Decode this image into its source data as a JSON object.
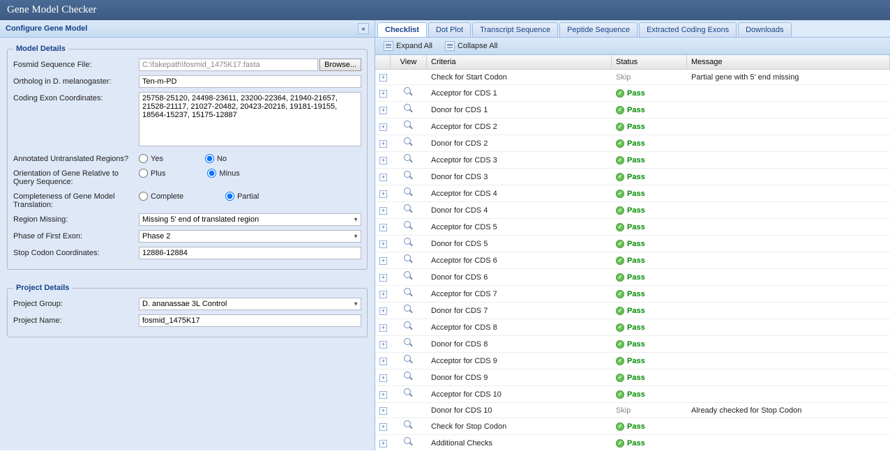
{
  "app": {
    "title": "Gene Model Checker"
  },
  "leftPanel": {
    "title": "Configure Gene Model"
  },
  "modelDetails": {
    "legend": "Model Details",
    "fields": {
      "fosmidLabel": "Fosmid Sequence File:",
      "fosmidValue": "C:\\fakepath\\fosmid_1475K17.fasta",
      "browseLabel": "Browse...",
      "orthologLabel": "Ortholog in D. melanogaster:",
      "orthologValue": "Ten-m-PD",
      "exonLabel": "Coding Exon Coordinates:",
      "exonValue": "25758-25120, 24498-23611, 23200-22364, 21940-21657, 21528-21117, 21027-20482, 20423-20216, 19181-19155, 18564-15237, 15175-12887",
      "utrLabel": "Annotated Untranslated Regions?",
      "utrYes": "Yes",
      "utrNo": "No",
      "orientLabel": "Orientation of Gene Relative to Query Sequence:",
      "orientPlus": "Plus",
      "orientMinus": "Minus",
      "completeLabel": "Completeness of Gene Model Translation:",
      "completeComplete": "Complete",
      "completePartial": "Partial",
      "regionLabel": "Region Missing:",
      "regionValue": "Missing 5' end of translated region",
      "phaseLabel": "Phase of First Exon:",
      "phaseValue": "Phase 2",
      "stopLabel": "Stop Codon Coordinates:",
      "stopValue": "12886-12884"
    }
  },
  "projectDetails": {
    "legend": "Project Details",
    "groupLabel": "Project Group:",
    "groupValue": "D. ananassae 3L Control",
    "nameLabel": "Project Name:",
    "nameValue": "fosmid_1475K17"
  },
  "tabs": [
    "Checklist",
    "Dot Plot",
    "Transcript Sequence",
    "Peptide Sequence",
    "Extracted Coding Exons",
    "Downloads"
  ],
  "toolbar": {
    "expandAll": "Expand All",
    "collapseAll": "Collapse All"
  },
  "gridHeaders": {
    "view": "View",
    "criteria": "Criteria",
    "status": "Status",
    "message": "Message"
  },
  "rows": [
    {
      "view": false,
      "criteria": "Check for Start Codon",
      "status": "Skip",
      "message": "Partial gene with 5' end missing"
    },
    {
      "view": true,
      "criteria": "Acceptor for CDS 1",
      "status": "Pass",
      "message": ""
    },
    {
      "view": true,
      "criteria": "Donor for CDS 1",
      "status": "Pass",
      "message": ""
    },
    {
      "view": true,
      "criteria": "Acceptor for CDS 2",
      "status": "Pass",
      "message": ""
    },
    {
      "view": true,
      "criteria": "Donor for CDS 2",
      "status": "Pass",
      "message": ""
    },
    {
      "view": true,
      "criteria": "Acceptor for CDS 3",
      "status": "Pass",
      "message": ""
    },
    {
      "view": true,
      "criteria": "Donor for CDS 3",
      "status": "Pass",
      "message": ""
    },
    {
      "view": true,
      "criteria": "Acceptor for CDS 4",
      "status": "Pass",
      "message": ""
    },
    {
      "view": true,
      "criteria": "Donor for CDS 4",
      "status": "Pass",
      "message": ""
    },
    {
      "view": true,
      "criteria": "Acceptor for CDS 5",
      "status": "Pass",
      "message": ""
    },
    {
      "view": true,
      "criteria": "Donor for CDS 5",
      "status": "Pass",
      "message": ""
    },
    {
      "view": true,
      "criteria": "Acceptor for CDS 6",
      "status": "Pass",
      "message": ""
    },
    {
      "view": true,
      "criteria": "Donor for CDS 6",
      "status": "Pass",
      "message": ""
    },
    {
      "view": true,
      "criteria": "Acceptor for CDS 7",
      "status": "Pass",
      "message": ""
    },
    {
      "view": true,
      "criteria": "Donor for CDS 7",
      "status": "Pass",
      "message": ""
    },
    {
      "view": true,
      "criteria": "Acceptor for CDS 8",
      "status": "Pass",
      "message": ""
    },
    {
      "view": true,
      "criteria": "Donor for CDS 8",
      "status": "Pass",
      "message": ""
    },
    {
      "view": true,
      "criteria": "Acceptor for CDS 9",
      "status": "Pass",
      "message": ""
    },
    {
      "view": true,
      "criteria": "Donor for CDS 9",
      "status": "Pass",
      "message": ""
    },
    {
      "view": true,
      "criteria": "Acceptor for CDS 10",
      "status": "Pass",
      "message": ""
    },
    {
      "view": false,
      "criteria": "Donor for CDS 10",
      "status": "Skip",
      "message": "Already checked for Stop Codon"
    },
    {
      "view": true,
      "criteria": "Check for Stop Codon",
      "status": "Pass",
      "message": ""
    },
    {
      "view": true,
      "criteria": "Additional Checks",
      "status": "Pass",
      "message": ""
    }
  ]
}
